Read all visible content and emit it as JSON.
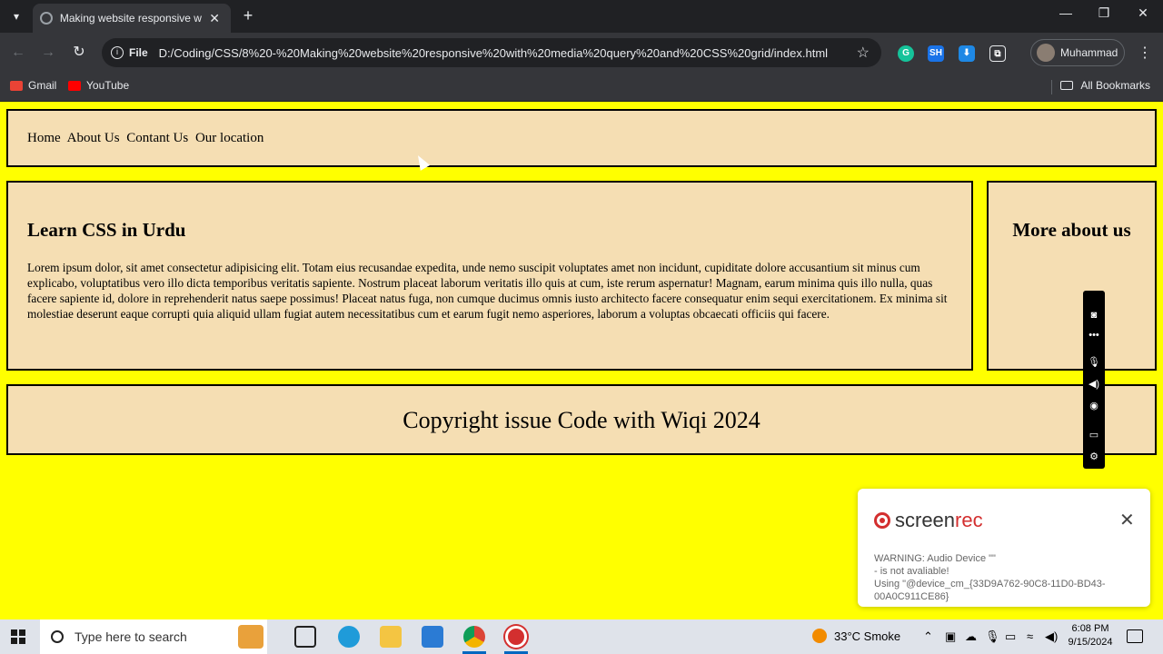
{
  "browser": {
    "tab_title": "Making website responsive with",
    "tab_close": "✕",
    "new_tab": "+",
    "window_controls": [
      "—",
      "❐",
      "✕"
    ],
    "address_chip": "File",
    "url": "D:/Coding/CSS/8%20-%20Making%20website%20responsive%20with%20media%20query%20and%20CSS%20grid/index.html",
    "profile_name": "Muhammad",
    "extensions": [
      {
        "name": "grammarly-icon",
        "label": "G",
        "color": "#15c39a"
      },
      {
        "name": "sh-extension-icon",
        "label": "SH",
        "color": "#1a73e8"
      },
      {
        "name": "download-extension-icon",
        "label": "⬇",
        "color": "#1e88e5"
      },
      {
        "name": "puzzle-icon",
        "label": "⧉",
        "color": "#35363a"
      }
    ],
    "bookmarks": [
      {
        "label": "Gmail",
        "color": "#ea4335"
      },
      {
        "label": "YouTube",
        "color": "#ff0000"
      }
    ],
    "all_bookmarks": "All Bookmarks"
  },
  "page": {
    "nav_links": [
      "Home",
      "About Us",
      "Contant Us",
      "Our location"
    ],
    "main_heading": "Learn CSS in Urdu",
    "main_paragraph": "Lorem ipsum dolor, sit amet consectetur adipisicing elit. Totam eius recusandae expedita, unde nemo suscipit voluptates amet non incidunt, cupiditate dolore accusantium sit minus cum explicabo, voluptatibus vero illo dicta temporibus veritatis sapiente. Nostrum placeat laborum veritatis illo quis at cum, iste rerum aspernatur! Magnam, earum minima quis illo nulla, quas facere sapiente id, dolore in reprehenderit natus saepe possimus! Placeat natus fuga, non cumque ducimus omnis iusto architecto facere consequatur enim sequi exercitationem. Ex minima sit molestiae deserunt eaque corrupti quia aliquid ullam fugiat autem necessitatibus cum et earum fugit nemo asperiores, laborum a voluptas obcaecati officiis qui facere.",
    "side_heading": "More about us",
    "footer_text": "Copyright issue Code with Wiqi 2024",
    "background_color": "#ffff00",
    "box_color": "#f5deb3"
  },
  "recorder": {
    "brand_plain": "screen",
    "brand_accent": "rec",
    "close": "✕",
    "warning": "WARNING: Audio Device \"\"\n- is not avaliable!\nUsing \"@device_cm_{33D9A762-90C8-11D0-BD43-00A0C911CE86}",
    "toolbar_icons": [
      "camera-icon",
      "dots-icon",
      "microphone-icon",
      "speaker-icon",
      "webcam-icon",
      "window-icon",
      "settings-icon"
    ]
  },
  "taskbar": {
    "search_placeholder": "Type here to search",
    "weather": "33°C  Smoke",
    "time": "6:08 PM",
    "date": "9/15/2024"
  }
}
